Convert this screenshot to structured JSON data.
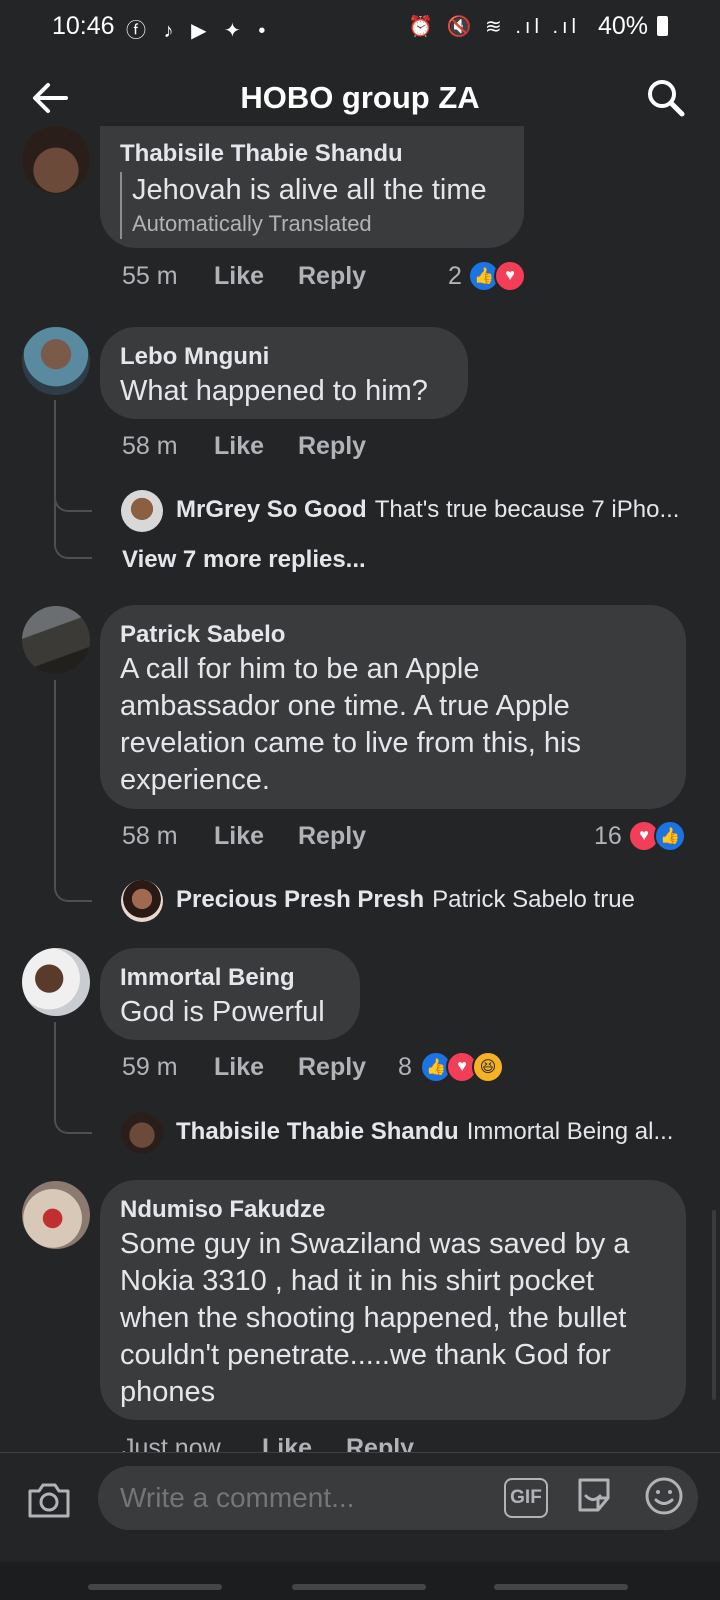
{
  "status_bar": {
    "time": "10:46",
    "left_icons": "ⓕ ♪ ▶ ✦ •",
    "right_icons": "⏰ 🔇 ≋ .ıl .ıl",
    "battery": "40%"
  },
  "header": {
    "title": "HOBO group ZA"
  },
  "comments": [
    {
      "name": "Thabisile Thabie Shandu",
      "text": "Jehovah is alive all the time",
      "translation_note": "Automatically Translated",
      "time": "55 m",
      "like_label": "Like",
      "reply_label": "Reply",
      "reaction_count": "2",
      "reactions": [
        "like",
        "love"
      ]
    },
    {
      "name": "Lebo Mnguni",
      "text": "What happened to him?",
      "time": "58 m",
      "like_label": "Like",
      "reply_label": "Reply",
      "reply_preview": {
        "name": "MrGrey So Good",
        "text": "That's true because 7 iPho..."
      },
      "more_replies": "View 7 more replies..."
    },
    {
      "name": "Patrick Sabelo",
      "text_lines": [
        "A call for him to be an Apple",
        "ambassador one time. A true Apple",
        "revelation came to live from this, his",
        "experience."
      ],
      "time": "58 m",
      "like_label": "Like",
      "reply_label": "Reply",
      "reaction_count": "16",
      "reactions": [
        "love",
        "like"
      ],
      "reply_preview": {
        "name": "Precious Presh Presh",
        "text": "Patrick Sabelo true"
      }
    },
    {
      "name": "Immortal Being",
      "text": "God is Powerful",
      "time": "59 m",
      "like_label": "Like",
      "reply_label": "Reply",
      "reaction_count": "8",
      "reactions": [
        "like",
        "love",
        "haha"
      ],
      "reply_preview": {
        "name": "Thabisile Thabie Shandu",
        "text": "Immortal Being al..."
      }
    },
    {
      "name": "Ndumiso Fakudze",
      "text_lines": [
        "Some guy in Swaziland was saved by a",
        "Nokia 3310 , had it in his shirt pocket",
        "when the shooting happened, the bullet",
        "couldn't penetrate.....we thank God for",
        "phones"
      ],
      "time": "Just now",
      "like_label": "Like",
      "reply_label": "Reply"
    }
  ],
  "composer": {
    "placeholder": "Write a comment...",
    "gif_label": "GIF"
  },
  "colors": {
    "background": "#242527",
    "bubble": "#3a3b3c",
    "like_blue": "#1b74e4",
    "love_red": "#f33e58",
    "haha_yellow": "#f7b125"
  }
}
